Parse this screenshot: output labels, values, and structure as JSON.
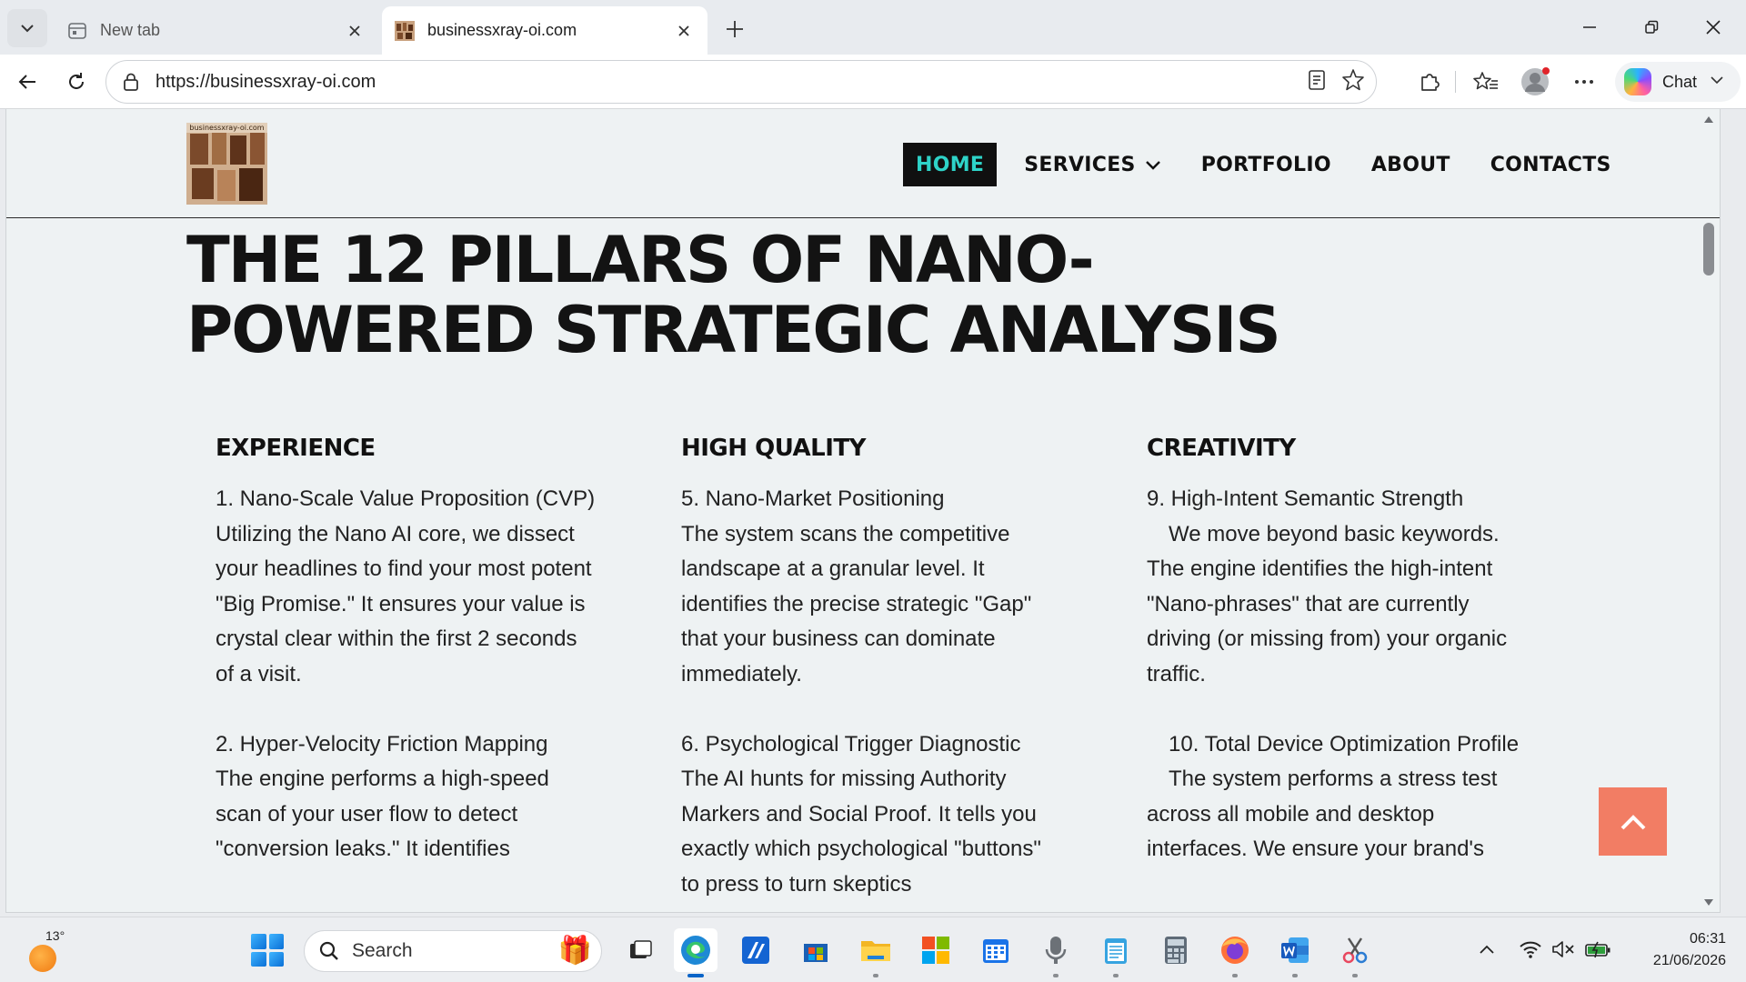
{
  "browser": {
    "tabs": [
      {
        "title": "New tab",
        "active": false
      },
      {
        "title": "businessxray-oi.com",
        "active": true
      }
    ],
    "url": "https://businessxray-oi.com",
    "chat_label": "Chat"
  },
  "site": {
    "logo_text": "businessxray-oi.com",
    "nav": [
      {
        "label": "HOME",
        "active": true
      },
      {
        "label": "SERVICES",
        "active": false,
        "has_dropdown": true
      },
      {
        "label": "PORTFOLIO",
        "active": false
      },
      {
        "label": "ABOUT",
        "active": false
      },
      {
        "label": "CONTACTS",
        "active": false
      }
    ],
    "title": "The 12 Pillars of Nano-Powered Strategic Analysis",
    "columns": [
      {
        "heading": "EXPERIENCE",
        "items": [
          {
            "title": "1. Nano-Scale Value Proposition (CVP)",
            "text": "Utilizing the Nano AI core, we dissect your headlines to find your most potent \"Big Promise.\" It ensures your value is crystal clear within the first 2 seconds of a visit."
          },
          {
            "title": "2. Hyper-Velocity Friction Mapping",
            "text": "The engine performs a high-speed scan of your user flow to detect \"conversion leaks.\" It identifies"
          }
        ]
      },
      {
        "heading": "HIGH QUALITY",
        "items": [
          {
            "title": "5. Nano-Market Positioning",
            "text": "The system scans the competitive landscape at a granular level. It identifies the precise strategic \"Gap\" that your business can dominate immediately."
          },
          {
            "title": "6. Psychological Trigger Diagnostic",
            "text": "The AI hunts for missing Authority Markers and Social Proof. It tells you exactly which psychological \"buttons\" to press to turn skeptics"
          }
        ]
      },
      {
        "heading": "CREATIVITY",
        "items": [
          {
            "title": "9. High-Intent Semantic Strength",
            "text": "We move beyond basic keywords. The engine identifies the high-intent \"Nano-phrases\" that are currently driving (or missing from) your organic traffic."
          },
          {
            "title": "10. Total Device Optimization Profile",
            "text": "The system performs a stress test across all mobile and desktop interfaces. We ensure your brand's"
          }
        ]
      }
    ]
  },
  "taskbar": {
    "temperature": "13°",
    "search_placeholder": "Search",
    "time": "06:31",
    "date": "21/06/2026"
  },
  "colors": {
    "nav_active_bg": "#101010",
    "nav_active_text": "#2ed3c8",
    "back_to_top": "#f27d64",
    "page_bg": "#eef2f3"
  }
}
